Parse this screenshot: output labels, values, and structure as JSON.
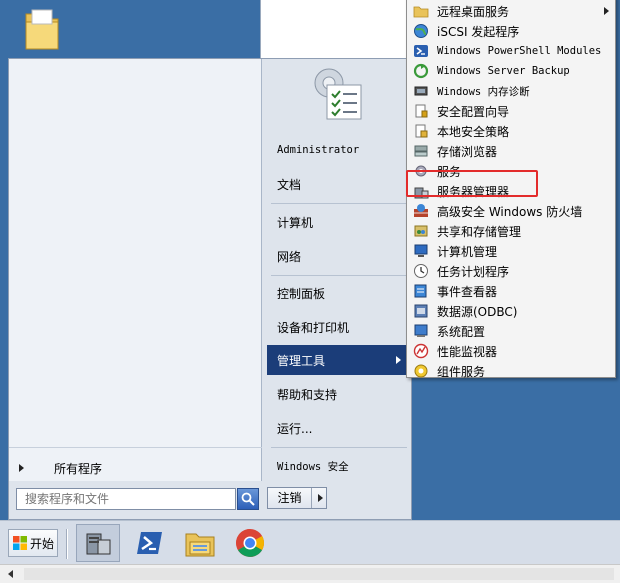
{
  "desktop": {
    "folder_icon": "folder-icon"
  },
  "start_menu": {
    "all_programs_label": "所有程序",
    "search_placeholder": "搜索程序和文件",
    "right_items": [
      {
        "label": "Administrator",
        "mono": true
      },
      {
        "label": "文档"
      },
      {
        "label": "计算机"
      },
      {
        "label": "网络"
      },
      {
        "label": "控制面板"
      },
      {
        "label": "设备和打印机"
      },
      {
        "label": "管理工具",
        "active": true
      },
      {
        "label": "帮助和支持"
      },
      {
        "label": "运行..."
      },
      {
        "label": "Windows 安全",
        "mono": true
      }
    ],
    "shutdown_label": "注销"
  },
  "admin_tools_submenu": {
    "items": [
      {
        "label": "远程桌面服务",
        "icon": "folder-icon",
        "has_submenu": true
      },
      {
        "label": "iSCSI 发起程序",
        "icon": "globe-icon"
      },
      {
        "label": "Windows PowerShell Modules",
        "icon": "powershell-icon",
        "mono": true
      },
      {
        "label": "Windows Server Backup",
        "icon": "backup-icon",
        "mono": true
      },
      {
        "label": "Windows 内存诊断",
        "icon": "memory-chip-icon",
        "mono_partial": true
      },
      {
        "label": "安全配置向导",
        "icon": "wizard-icon"
      },
      {
        "label": "本地安全策略",
        "icon": "security-policy-icon"
      },
      {
        "label": "存储浏览器",
        "icon": "storage-icon"
      },
      {
        "label": "服务",
        "icon": "gear-icon"
      },
      {
        "label": "服务器管理器",
        "icon": "server-manager-icon"
      },
      {
        "label": "高级安全 Windows 防火墙",
        "icon": "firewall-icon"
      },
      {
        "label": "共享和存储管理",
        "icon": "share-storage-icon"
      },
      {
        "label": "计算机管理",
        "icon": "computer-management-icon"
      },
      {
        "label": "任务计划程序",
        "icon": "clock-icon"
      },
      {
        "label": "事件查看器",
        "icon": "event-viewer-icon"
      },
      {
        "label": "数据源(ODBC)",
        "icon": "database-icon"
      },
      {
        "label": "系统配置",
        "icon": "system-config-icon"
      },
      {
        "label": "性能监视器",
        "icon": "performance-monitor-icon"
      },
      {
        "label": "组件服务",
        "icon": "component-services-icon"
      }
    ]
  },
  "taskbar": {
    "start_label": "开始",
    "pinned": [
      "server-manager-icon",
      "powershell-icon",
      "file-explorer-icon",
      "chrome-icon"
    ]
  },
  "colors": {
    "desktop_bg": "#3a6ea5",
    "active_item_bg": "#1b3d79",
    "highlight_box": "#e32b2b"
  }
}
